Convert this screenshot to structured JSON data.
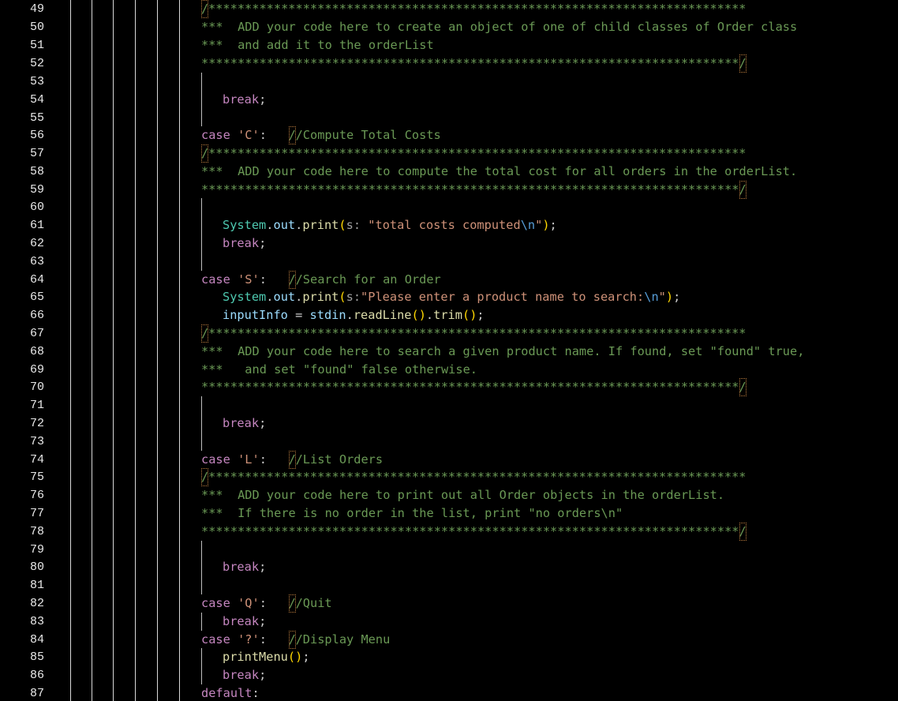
{
  "editor": {
    "line_numbers": [
      "49",
      "50",
      "51",
      "52",
      "53",
      "54",
      "55",
      "56",
      "57",
      "58",
      "59",
      "60",
      "61",
      "62",
      "63",
      "64",
      "65",
      "66",
      "67",
      "68",
      "69",
      "70",
      "71",
      "72",
      "73",
      "74",
      "75",
      "76",
      "77",
      "78",
      "79",
      "80",
      "81",
      "82",
      "83",
      "84",
      "85",
      "86",
      "87"
    ],
    "banner_open": "/**************************************************************************",
    "banner_close": "**************************************************************************/",
    "comment_prefix": "***  ",
    "block1": {
      "line1": "ADD your code here to create an object of one of child classes of Order class",
      "line2": "and add it to the orderList"
    },
    "block2": {
      "line1": "ADD your code here to compute the total cost for all orders in the orderList."
    },
    "block3": {
      "line1": "ADD your code here to search a given product name. If found, set \"found\" true,",
      "line2": "and set \"found\" false otherwise."
    },
    "block4": {
      "line1": "ADD your code here to print out all Order objects in the orderList.",
      "line2": "If there is no order in the list, print \"no orders\\n\""
    },
    "tokens": {
      "break": "break",
      "semicolon": ";",
      "case": "case",
      "colon": ":",
      "slashes": "//",
      "system": "System",
      "dot": ".",
      "out": "out",
      "print": "print",
      "open_paren": "(",
      "close_paren": ")",
      "param_hint": "s:",
      "quote": "\"",
      "newline_escape": "\\n",
      "input_info": "inputInfo",
      "equals": " = ",
      "stdin": "stdin",
      "read_line": "readLine",
      "trim": "trim",
      "print_menu": "printMenu",
      "default": "default",
      "empty_parens": "()"
    },
    "case_c": {
      "label": "'C'",
      "comment": "Compute Total Costs"
    },
    "case_s": {
      "label": "'S'",
      "comment": "Search for an Order"
    },
    "case_l": {
      "label": "'L'",
      "comment": "List Orders"
    },
    "case_q": {
      "label": "'Q'",
      "comment": "Quit"
    },
    "case_help": {
      "label": "'?'",
      "comment": "Display Menu"
    },
    "strings": {
      "total_costs": "total costs computed",
      "prompt": "Please enter a product name to search:"
    }
  }
}
